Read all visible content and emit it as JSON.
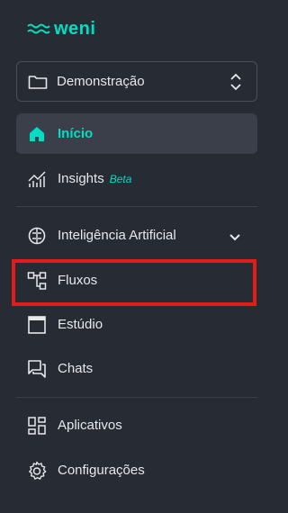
{
  "logo": {
    "text": "weni"
  },
  "project_selector": {
    "value": "Demonstração"
  },
  "nav": {
    "inicio": "Início",
    "insights": "Insights",
    "insights_badge": "Beta",
    "ia": "Inteligência Artificial",
    "fluxos": "Fluxos",
    "estudio": "Estúdio",
    "chats": "Chats",
    "aplicativos": "Aplicativos",
    "configuracoes": "Configurações"
  },
  "colors": {
    "background": "#272b33",
    "accent": "#00dec5",
    "active_bg": "#3a3f4a",
    "highlight": "#e31b1b"
  },
  "icons": {
    "logo": "weni-waves-icon",
    "project": "folder-icon",
    "project_toggle": "unfold-icon",
    "inicio": "home-icon",
    "insights": "chart-icon",
    "ia": "brain-icon",
    "ia_toggle": "chevron-down-icon",
    "fluxos": "flow-icon",
    "estudio": "window-icon",
    "chats": "chat-icon",
    "aplicativos": "apps-icon",
    "configuracoes": "gear-icon"
  }
}
